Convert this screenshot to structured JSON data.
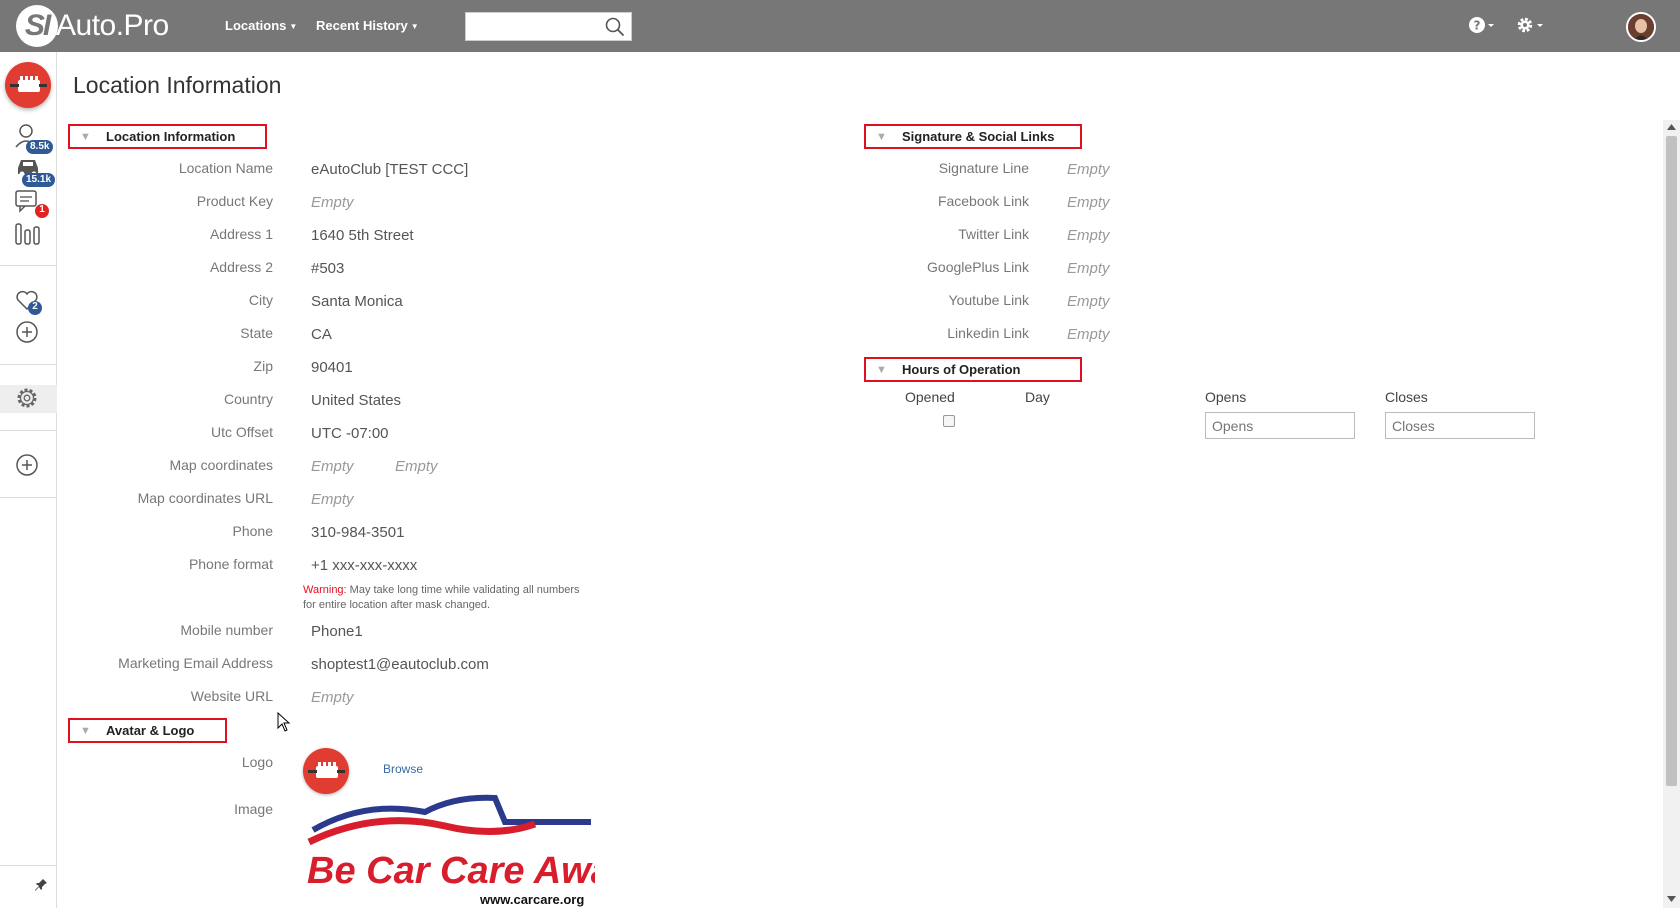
{
  "app": {
    "logo_mark": "SI",
    "logo_text": "Auto.Pro"
  },
  "topnav": {
    "items": [
      {
        "label": "Locations"
      },
      {
        "label": "Recent History"
      }
    ],
    "search_placeholder": ""
  },
  "sidebar": {
    "customers_badge": "8.5k",
    "vehicles_badge": "15.1k",
    "messages_badge": "1",
    "favorites_badge": "2"
  },
  "page": {
    "title": "Location Information"
  },
  "location_section": {
    "header": "Location Information",
    "fields": [
      {
        "label": "Location Name",
        "value": "eAutoClub [TEST CCC]"
      },
      {
        "label": "Product Key",
        "value": "Empty"
      },
      {
        "label": "Address 1",
        "value": "1640 5th Street"
      },
      {
        "label": "Address 2",
        "value": "#503"
      },
      {
        "label": "City",
        "value": "Santa Monica"
      },
      {
        "label": "State",
        "value": "CA"
      },
      {
        "label": "Zip",
        "value": "90401"
      },
      {
        "label": "Country",
        "value": "United States"
      },
      {
        "label": "Utc Offset",
        "value": "UTC -07:00"
      },
      {
        "label": "Map coordinates",
        "value": "Empty",
        "value2": "Empty"
      },
      {
        "label": "Map coordinates URL",
        "value": "Empty"
      },
      {
        "label": "Phone",
        "value": "310-984-3501"
      },
      {
        "label": "Phone format",
        "value": "+1 xxx-xxx-xxxx"
      },
      {
        "label": "Mobile number",
        "value": "Phone1"
      },
      {
        "label": "Marketing Email Address",
        "value": "shoptest1@eautoclub.com"
      },
      {
        "label": "Website URL",
        "value": "Empty"
      }
    ],
    "warning_label": "Warning:",
    "warning_text": " May take long time while validating all numbers for entire location after mask changed."
  },
  "avatar_section": {
    "header": "Avatar & Logo",
    "logo_label": "Logo",
    "image_label": "Image",
    "browse_label": "Browse",
    "image_text_main": "Be Car Care Aware",
    "image_text_url": "www.carcare.org"
  },
  "signature_section": {
    "header": "Signature & Social Links",
    "fields": [
      {
        "label": "Signature Line",
        "value": "Empty"
      },
      {
        "label": "Facebook Link",
        "value": "Empty"
      },
      {
        "label": "Twitter Link",
        "value": "Empty"
      },
      {
        "label": "GooglePlus Link",
        "value": "Empty"
      },
      {
        "label": "Youtube Link",
        "value": "Empty"
      },
      {
        "label": "Linkedin Link",
        "value": "Empty"
      }
    ]
  },
  "hours_section": {
    "header": "Hours of Operation",
    "columns": {
      "opened": "Opened",
      "day": "Day",
      "opens": "Opens",
      "closes": "Closes"
    },
    "opens_placeholder": "Opens",
    "closes_placeholder": "Closes"
  },
  "colors": {
    "topbar": "#777777",
    "brand_red": "#e03c31",
    "section_border": "#e01020",
    "badge_blue": "#2f5a96"
  }
}
